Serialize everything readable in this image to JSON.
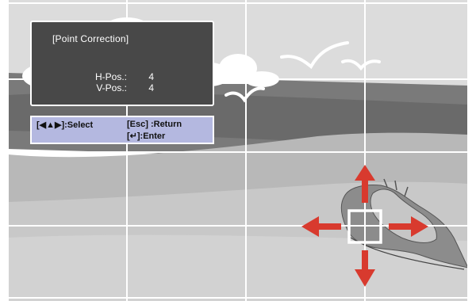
{
  "osd": {
    "title": "[Point Correction]",
    "h_pos_label": "H-Pos.:",
    "h_pos_value": "4",
    "v_pos_label": "V-Pos.:",
    "v_pos_value": "4"
  },
  "help": {
    "select_key": "[◀▲▶]",
    "select_label": ":Select",
    "return_key": "[Esc]",
    "return_label": " :Return",
    "enter_key": "[↵]",
    "enter_label": ":Enter"
  },
  "colors": {
    "arrow": "#d83a2e",
    "grid": "#ffffff",
    "osd_bg": "#484848",
    "help_bg": "#b4b8e0"
  },
  "icons": [
    "arrow-up-icon",
    "arrow-down-icon",
    "arrow-left-icon",
    "arrow-right-icon",
    "correction-point-icon"
  ]
}
